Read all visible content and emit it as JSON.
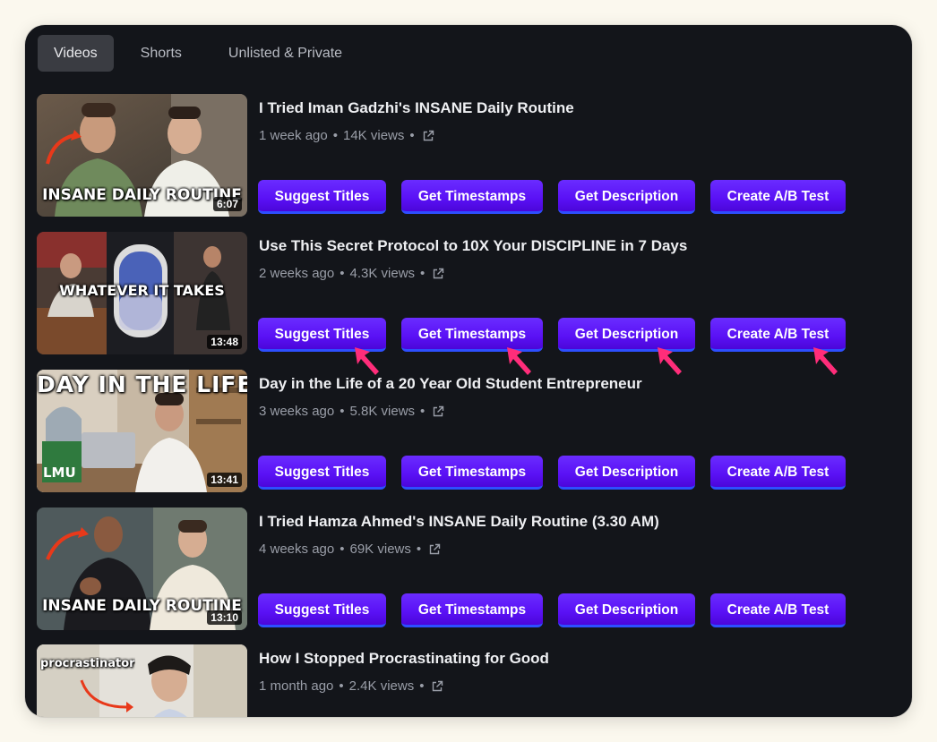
{
  "tabs": [
    {
      "label": "Videos",
      "active": true
    },
    {
      "label": "Shorts",
      "active": false
    },
    {
      "label": "Unlisted & Private",
      "active": false
    }
  ],
  "action_labels": {
    "suggest_titles": "Suggest Titles",
    "get_timestamps": "Get Timestamps",
    "get_description": "Get Description",
    "create_ab_test": "Create A/B Test"
  },
  "separator": "•",
  "videos": [
    {
      "title": "I Tried Iman Gadzhi's INSANE Daily Routine",
      "age": "1 week ago",
      "views": "14K views",
      "duration": "6:07",
      "thumb_text": "INSANE DAILY ROUTINE"
    },
    {
      "title": "Use This Secret Protocol to 10X Your DISCIPLINE in 7 Days",
      "age": "2 weeks ago",
      "views": "4.3K views",
      "duration": "13:48",
      "thumb_text": "WHATEVER IT TAKES"
    },
    {
      "title": "Day in the Life of a 20 Year Old Student Entrepreneur",
      "age": "3 weeks ago",
      "views": "5.8K views",
      "duration": "13:41",
      "thumb_text": "DAY IN THE LIFE",
      "thumb_logo": "LMU"
    },
    {
      "title": "I Tried Hamza Ahmed's INSANE Daily Routine (3.30 AM)",
      "age": "4 weeks ago",
      "views": "69K views",
      "duration": "13:10",
      "thumb_text": "INSANE DAILY ROUTINE"
    },
    {
      "title": "How I Stopped Procrastinating for Good",
      "age": "1 month ago",
      "views": "2.4K views",
      "thumb_text": "procrastinator"
    }
  ],
  "colors": {
    "panel_bg": "#13151a",
    "button_gradient_top": "#6a2cff",
    "button_gradient_bottom": "#4b06d9",
    "button_underline": "#2d4fff",
    "pointer_arrow": "#ff2d7a"
  },
  "icons": {
    "external_link": "external-link-icon",
    "annotation_arrow": "pointer-arrow-icon"
  }
}
